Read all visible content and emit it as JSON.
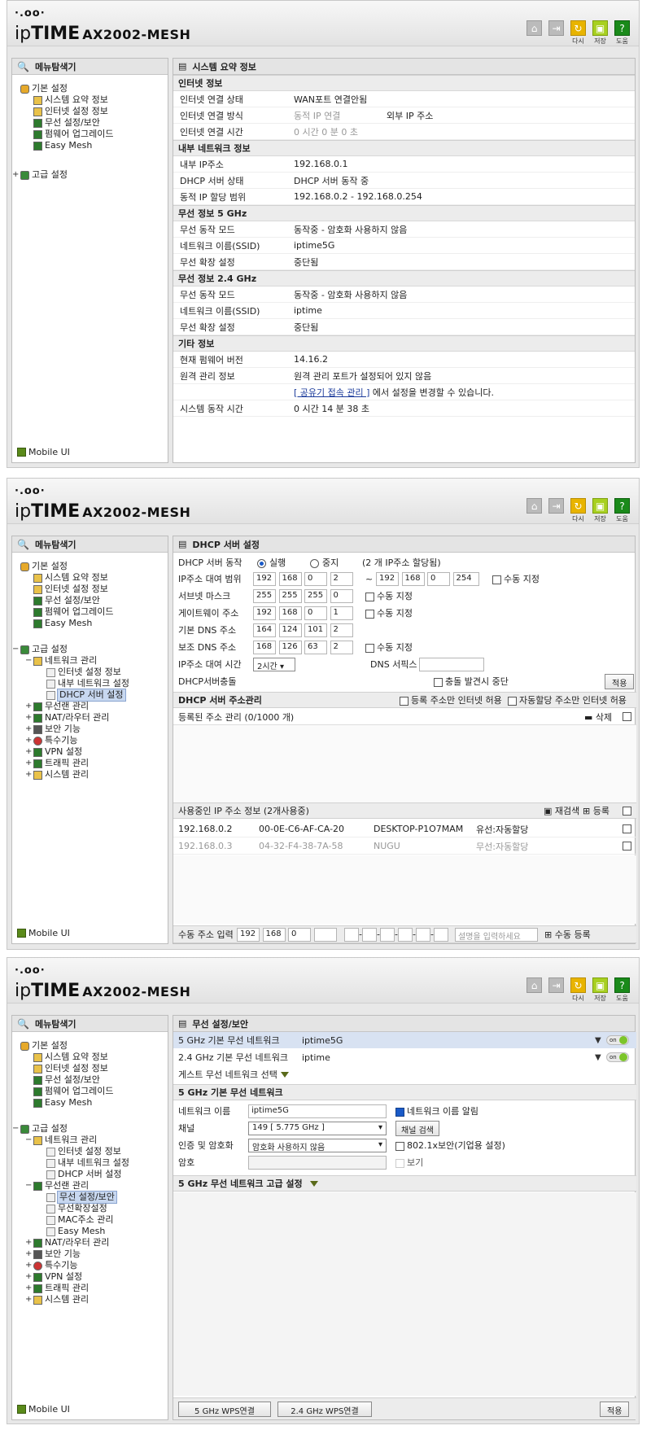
{
  "brand": {
    "dots": "·.oo·",
    "name_ip": "ip",
    "name_time": "TIME",
    "model": "AX2002-MESH"
  },
  "header_buttons": [
    {
      "icon": "home-icon",
      "label": ""
    },
    {
      "icon": "logout-icon",
      "label": ""
    },
    {
      "icon": "restart-icon",
      "label": "다시"
    },
    {
      "icon": "save-icon",
      "label": "저장"
    },
    {
      "icon": "help-icon",
      "label": "도움"
    }
  ],
  "sidebar": {
    "title": "메뉴탐색기",
    "mobile": "Mobile UI"
  },
  "screen1": {
    "tree": {
      "basic": "기본 설정",
      "items": [
        "시스템 요약 정보",
        "인터넷 설정 정보",
        "무선 설정/보안",
        "펌웨어 업그레이드",
        "Easy Mesh"
      ],
      "advanced": "고급 설정"
    },
    "panel_title": "시스템 요약 정보",
    "sections": [
      {
        "title": "인터넷 정보",
        "rows": [
          {
            "label": "인터넷 연결 상태",
            "value": "WAN포트 연결안됨",
            "extra": ""
          },
          {
            "label": "인터넷 연결 방식",
            "value": "동적 IP 연결",
            "extra": "외부 IP 주소"
          },
          {
            "label": "인터넷 연결 시간",
            "value": "0 시간 0 분 0 초",
            "extra": ""
          }
        ]
      },
      {
        "title": "내부 네트워크 정보",
        "rows": [
          {
            "label": "내부 IP주소",
            "value": "192.168.0.1",
            "extra": ""
          },
          {
            "label": "DHCP 서버 상태",
            "value": "DHCP 서버 동작 중",
            "extra": ""
          },
          {
            "label": "동적 IP 할당 범위",
            "value": "192.168.0.2 -  192.168.0.254",
            "extra": ""
          }
        ]
      },
      {
        "title": "무선 정보 5 GHz",
        "rows": [
          {
            "label": "무선 동작 모드",
            "value": "동작중 - 암호화 사용하지 않음",
            "extra": ""
          },
          {
            "label": "네트워크 이름(SSID)",
            "value": "iptime5G",
            "extra": ""
          },
          {
            "label": "무선 확장 설정",
            "value": "중단됨",
            "extra": ""
          }
        ]
      },
      {
        "title": "무선 정보 2.4 GHz",
        "rows": [
          {
            "label": "무선 동작 모드",
            "value": "동작중 - 암호화 사용하지 않음",
            "extra": ""
          },
          {
            "label": "네트워크 이름(SSID)",
            "value": "iptime",
            "extra": ""
          },
          {
            "label": "무선 확장 설정",
            "value": "중단됨",
            "extra": ""
          }
        ]
      },
      {
        "title": "기타 정보",
        "rows": [
          {
            "label": "현재 펌웨어 버전",
            "value": "14.16.2",
            "extra": ""
          },
          {
            "label": "원격 관리 정보",
            "value": "원격 관리 포트가 설정되어 있지 않음",
            "extra": ""
          }
        ]
      }
    ],
    "remote_link": "[ 공유기 접속 관리 ]",
    "remote_link_suffix": " 에서 설정을 변경할 수 있습니다.",
    "uptime_label": "시스템 동작 시간",
    "uptime_value": "0 시간 14 분 38 초"
  },
  "screen2": {
    "tree": {
      "basic": "기본 설정",
      "basic_items": [
        "시스템 요약 정보",
        "인터넷 설정 정보",
        "무선 설정/보안",
        "펌웨어 업그레이드",
        "Easy Mesh"
      ],
      "advanced": "고급 설정",
      "network": "네트워크 관리",
      "network_items": [
        "인터넷 설정 정보",
        "내부 네트워크 설정",
        "DHCP 서버 설정"
      ],
      "others": [
        "무선랜 관리",
        "NAT/라우터 관리",
        "보안 기능",
        "특수기능",
        "VPN 설정",
        "트래픽 관리",
        "시스템 관리"
      ]
    },
    "panel_title": "DHCP 서버 설정",
    "dhcp_op_label": "DHCP 서버 동작",
    "run": "실행",
    "stop": "중지",
    "assigned": "(2 개 IP주소 할당됨)",
    "ip_range_label": "IP주소 대여 범위",
    "ip_start": [
      "192",
      "168",
      "0",
      "2"
    ],
    "tilde": "~",
    "ip_end": [
      "192",
      "168",
      "0",
      "254"
    ],
    "manual": "수동 지정",
    "subnet_label": "서브넷 마스크",
    "subnet": [
      "255",
      "255",
      "255",
      "0"
    ],
    "gateway_label": "게이트웨이 주소",
    "gateway": [
      "192",
      "168",
      "0",
      "1"
    ],
    "dns1_label": "기본 DNS 주소",
    "dns1": [
      "164",
      "124",
      "101",
      "2"
    ],
    "dns2_label": "보조 DNS 주소",
    "dns2": [
      "168",
      "126",
      "63",
      "2"
    ],
    "lease_label": "IP주소 대여 시간",
    "lease_value": "2시간",
    "dns_suffix_label": "DNS 서픽스",
    "conflict_label": "DHCP서버충돌",
    "conflict_option": "충돌 발견시 중단",
    "apply": "적용",
    "addr_mgmt": "DHCP 서버 주소관리",
    "reg_only": "등록 주소만 인터넷 허용",
    "auto_only": "자동할당 주소만 인터넷 허용",
    "registered": "등록된 주소 관리 (0/1000 개)",
    "delete": "삭제",
    "in_use": "사용중인 IP 주소 정보 (2개사용중)",
    "rescan": "재검색",
    "register": "등록",
    "clients": [
      {
        "ip": "192.168.0.2",
        "mac": "00-0E-C6-AF-CA-20",
        "name": "DESKTOP-P1O7MAM",
        "type": "유선:자동할당",
        "dim": false
      },
      {
        "ip": "192.168.0.3",
        "mac": "04-32-F4-38-7A-58",
        "name": "NUGU",
        "type": "무선:자동할당",
        "dim": true
      }
    ],
    "manual_entry_label": "수동 주소 입력",
    "manual_ip": [
      "192",
      "168",
      "0",
      ""
    ],
    "desc_placeholder": "설명을 입력하세요",
    "manual_register": "수동 등록"
  },
  "screen3": {
    "tree": {
      "basic": "기본 설정",
      "basic_items": [
        "시스템 요약 정보",
        "인터넷 설정 정보",
        "무선 설정/보안",
        "펌웨어 업그레이드",
        "Easy Mesh"
      ],
      "advanced": "고급 설정",
      "network": "네트워크 관리",
      "network_items": [
        "인터넷 설정 정보",
        "내부 네트워크 설정",
        "DHCP 서버 설정"
      ],
      "wireless": "무선랜 관리",
      "wireless_items": [
        "무선 설정/보안",
        "무선확장설정",
        "MAC주소 관리",
        "Easy Mesh"
      ],
      "others": [
        "NAT/라우터 관리",
        "보안 기능",
        "특수기능",
        "VPN 설정",
        "트래픽 관리",
        "시스템 관리"
      ]
    },
    "panel_title": "무선 설정/보안",
    "net5_label": "5 GHz 기본 무선 네트워크",
    "net5_ssid": "iptime5G",
    "net24_label": "2.4 GHz 기본 무선 네트워크",
    "net24_ssid": "iptime",
    "on": "on",
    "guest": "게스트 무선 네트워크 선택",
    "sub_title": "5 GHz 기본 무선 네트워크",
    "name_label": "네트워크 이름",
    "name_value": "iptime5G",
    "broadcast": "네트워크 이름 알림",
    "channel_label": "채널",
    "channel_value": "149 [ 5.775 GHz ]",
    "channel_scan": "채널 검색",
    "auth_label": "인증 및 암호화",
    "auth_value": "암호화 사용하지 않음",
    "dot1x": "802.1x보안(기업용 설정)",
    "pw_label": "암호",
    "show": "보기",
    "advanced": "5 GHz 무선 네트워크 고급 설정",
    "wps5": "5 GHz WPS연결",
    "wps24": "2.4 GHz WPS연결",
    "apply": "적용"
  }
}
